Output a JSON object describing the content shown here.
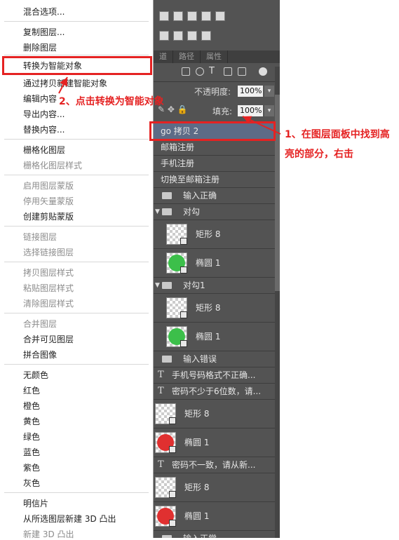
{
  "menu": {
    "items": [
      {
        "label": "混合选项...",
        "enabled": true
      },
      {
        "label": "复制图层...",
        "enabled": true
      },
      {
        "label": "删除图层",
        "enabled": true
      },
      {
        "label": "转换为智能对象",
        "enabled": true
      },
      {
        "label": "通过拷贝新建智能对象",
        "enabled": true
      },
      {
        "label": "编辑内容",
        "enabled": true
      },
      {
        "label": "导出内容...",
        "enabled": true
      },
      {
        "label": "替换内容...",
        "enabled": true
      },
      {
        "label": "栅格化图层",
        "enabled": true
      },
      {
        "label": "栅格化图层样式",
        "enabled": false
      },
      {
        "label": "启用图层蒙版",
        "enabled": false
      },
      {
        "label": "停用矢量蒙版",
        "enabled": false
      },
      {
        "label": "创建剪贴蒙版",
        "enabled": true
      },
      {
        "label": "链接图层",
        "enabled": false
      },
      {
        "label": "选择链接图层",
        "enabled": false
      },
      {
        "label": "拷贝图层样式",
        "enabled": false
      },
      {
        "label": "粘贴图层样式",
        "enabled": false
      },
      {
        "label": "清除图层样式",
        "enabled": false
      },
      {
        "label": "合并图层",
        "enabled": false
      },
      {
        "label": "合并可见图层",
        "enabled": true
      },
      {
        "label": "拼合图像",
        "enabled": true
      },
      {
        "label": "无颜色",
        "enabled": true
      },
      {
        "label": "红色",
        "enabled": true
      },
      {
        "label": "橙色",
        "enabled": true
      },
      {
        "label": "黄色",
        "enabled": true
      },
      {
        "label": "绿色",
        "enabled": true
      },
      {
        "label": "蓝色",
        "enabled": true
      },
      {
        "label": "紫色",
        "enabled": true
      },
      {
        "label": "灰色",
        "enabled": true
      },
      {
        "label": "明信片",
        "enabled": true
      },
      {
        "label": "从所选图层新建 3D 凸出",
        "enabled": true
      },
      {
        "label": "新建 3D 凸出",
        "enabled": false
      }
    ]
  },
  "panel": {
    "tabs": [
      "道",
      "路径",
      "属性"
    ],
    "opacity_label": "不透明度:",
    "opacity_value": "100%",
    "fill_label": "填充:",
    "fill_value": "100%"
  },
  "layers": [
    {
      "name": "go 拷贝 2",
      "kind": "text-plain",
      "selected": true
    },
    {
      "name": "邮箱注册",
      "kind": "text-plain"
    },
    {
      "name": "手机注册",
      "kind": "text-plain"
    },
    {
      "name": "切换至邮箱注册",
      "kind": "text-plain"
    },
    {
      "name": "输入正确",
      "kind": "group-closed"
    },
    {
      "name": "对勾",
      "kind": "group-open"
    },
    {
      "name": "矩形 8",
      "kind": "shape-rect",
      "indent": true
    },
    {
      "name": "椭圆 1",
      "kind": "shape-ellipse",
      "color": "#3cbf4a",
      "indent": true
    },
    {
      "name": "对勾1",
      "kind": "group-open"
    },
    {
      "name": "矩形 8",
      "kind": "shape-rect",
      "indent": true
    },
    {
      "name": "椭圆 1",
      "kind": "shape-ellipse",
      "color": "#3cbf4a",
      "indent": true
    },
    {
      "name": "输入错误",
      "kind": "group-closed"
    },
    {
      "name": "手机号码格式不正确...",
      "kind": "text-icon"
    },
    {
      "name": "密码不少于6位数，请...",
      "kind": "text-icon"
    },
    {
      "name": "矩形 8",
      "kind": "shape-rect"
    },
    {
      "name": "椭圆 1",
      "kind": "shape-ellipse",
      "color": "#e03030"
    },
    {
      "name": "密码不一致，请从新...",
      "kind": "text-icon"
    },
    {
      "name": "矩形 8",
      "kind": "shape-rect"
    },
    {
      "name": "椭圆 1",
      "kind": "shape-ellipse",
      "color": "#e03030"
    },
    {
      "name": "输入正常",
      "kind": "group-closed"
    }
  ],
  "annotations": {
    "step1": "1、在图层面板中找到高亮的部分，右击",
    "step2": "2、点击转换为智能对象"
  },
  "colors": {
    "annotation": "#e52222",
    "panel": "#535353",
    "selected_layer": "#5d6b86"
  }
}
